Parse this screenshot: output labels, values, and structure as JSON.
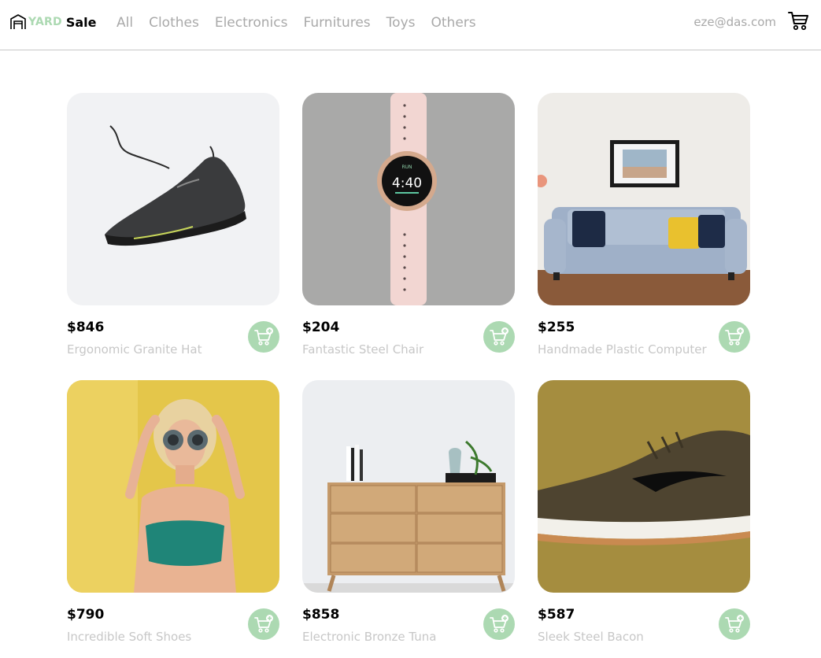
{
  "brand": {
    "yard": "YARD",
    "sale": "Sale",
    "accent_color": "#acd9b2",
    "icon": "garage-logo-icon"
  },
  "nav": {
    "categories": [
      {
        "label": "All"
      },
      {
        "label": "Clothes"
      },
      {
        "label": "Electronics"
      },
      {
        "label": "Furnitures"
      },
      {
        "label": "Toys"
      },
      {
        "label": "Others"
      }
    ],
    "user_email": "eze@das.com",
    "cart_icon": "shopping-cart-icon"
  },
  "products": [
    {
      "price": "$846",
      "name": "Ergonomic Granite Hat",
      "image": "running-shoe-photo"
    },
    {
      "price": "$204",
      "name": "Fantastic Steel Chair",
      "image": "smartwatch-photo"
    },
    {
      "price": "$255",
      "name": "Handmade Plastic Computer",
      "image": "sofa-photo"
    },
    {
      "price": "$790",
      "name": "Incredible Soft Shoes",
      "image": "woman-sunglasses-photo"
    },
    {
      "price": "$858",
      "name": "Electronic Bronze Tuna",
      "image": "wooden-dresser-photo"
    },
    {
      "price": "$587",
      "name": "Sleek Steel Bacon",
      "image": "suede-sneaker-photo"
    }
  ],
  "add_to_cart_icon": "add-to-cart-icon",
  "colors": {
    "nav_text": "#a9a9a9",
    "product_name": "#c7c7c7",
    "button_bg": "#acd9b2"
  }
}
